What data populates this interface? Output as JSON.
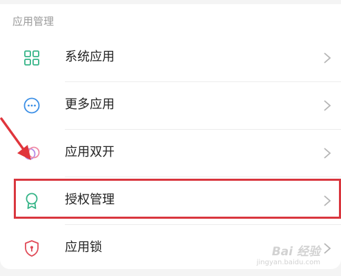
{
  "section": {
    "title": "应用管理"
  },
  "items": [
    {
      "label": "系统应用",
      "icon": "grid-apps-icon"
    },
    {
      "label": "更多应用",
      "icon": "more-dots-icon"
    },
    {
      "label": "应用双开",
      "icon": "dual-app-icon"
    },
    {
      "label": "授权管理",
      "icon": "award-ribbon-icon"
    },
    {
      "label": "应用锁",
      "icon": "shield-lock-icon"
    }
  ],
  "watermark": {
    "main": "Bai 经验",
    "sub": "jingyan.baidu.com"
  },
  "colors": {
    "accent_green": "#35b487",
    "accent_blue": "#3b8fe6",
    "highlight_red": "#d9363e",
    "lock_red": "#e04a57"
  }
}
